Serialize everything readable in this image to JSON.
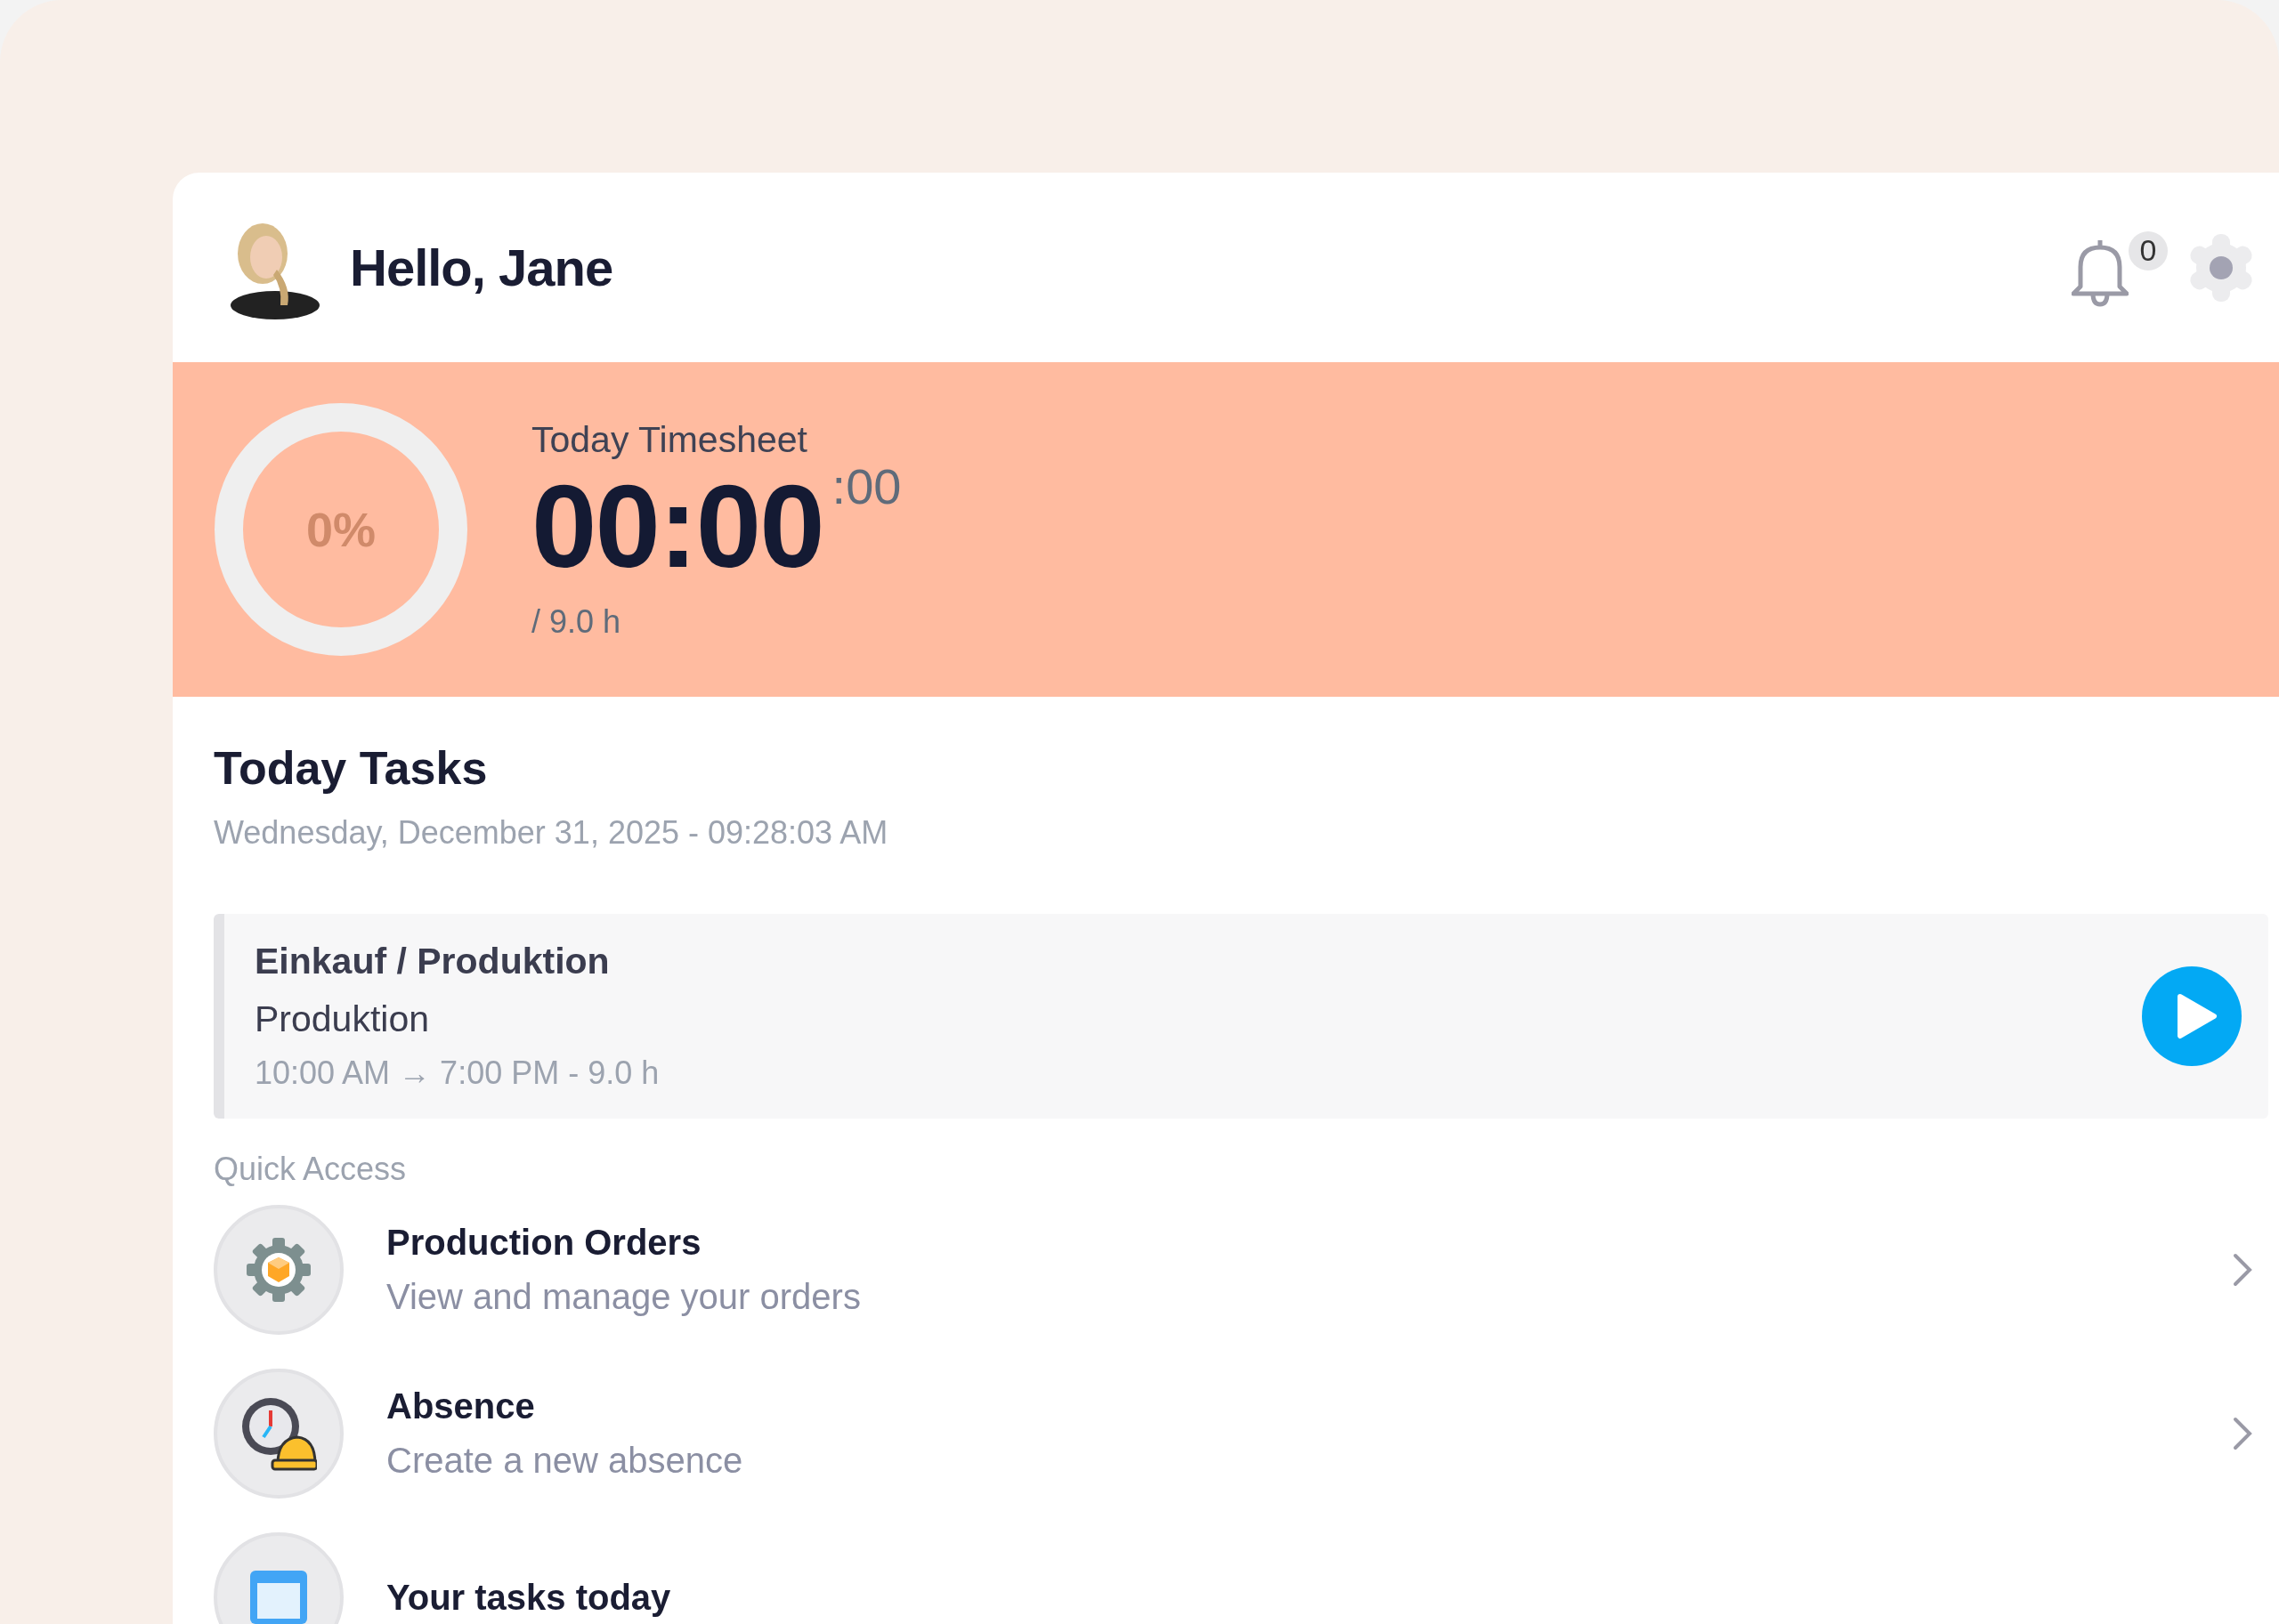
{
  "header": {
    "greeting": "Hello, Jane",
    "notifications": {
      "count": "0"
    }
  },
  "timesheet": {
    "title": "Today Timesheet",
    "percent": "0%",
    "level": 0,
    "time": "00:00",
    "seconds": ":00",
    "target": "/ 9.0 h"
  },
  "tasks": {
    "title": "Today Tasks",
    "date": "Wednesday, December 31, 2025 - 09:28:03 AM",
    "items": [
      {
        "group": "Einkauf / Produktion",
        "name": "Produktion",
        "time": "10:00 AM → 7:00 PM - 9.0 h"
      }
    ]
  },
  "quick_access": {
    "title": "Quick Access",
    "items": [
      {
        "kind": "orders",
        "title": "Production Orders",
        "subtitle": "View and manage your orders"
      },
      {
        "kind": "absence",
        "title": "Absence",
        "subtitle": "Create a new absence"
      },
      {
        "kind": "tasks",
        "title": "Your tasks today"
      }
    ]
  }
}
